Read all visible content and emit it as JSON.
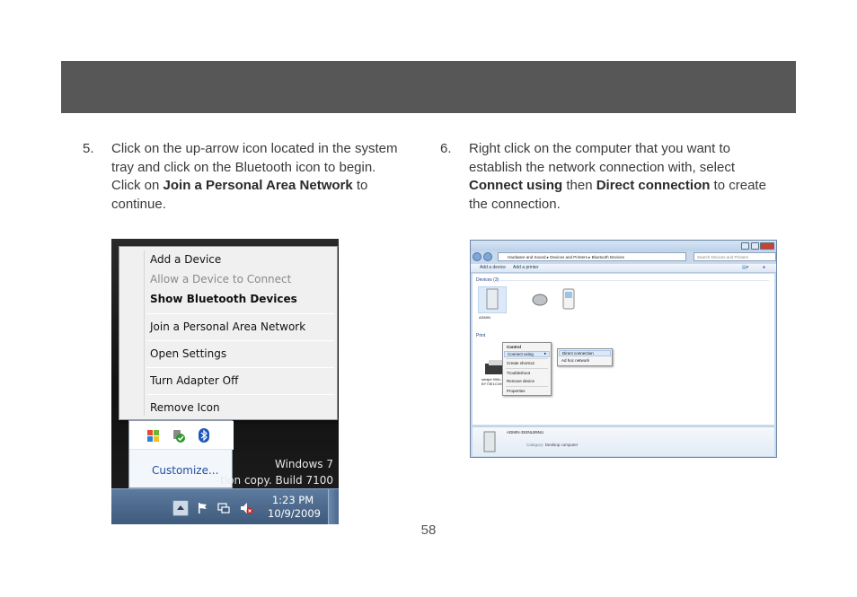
{
  "step5": {
    "number": "5.",
    "text_a": "Click on the up-arrow icon located in the system tray and click on the Bluetooth icon to begin.  Click on ",
    "bold_a": "Join a Personal Area Network",
    "text_b": " to continue."
  },
  "step6": {
    "number": "6.",
    "text_a": "Right click on the computer that you want to establish the network connection with, select ",
    "bold_a": "Connect using",
    "text_b": " then ",
    "bold_b": "Direct connection",
    "text_c": " to create the connection."
  },
  "bluetooth_menu": {
    "items": [
      "Add a Device",
      "Allow a Device to Connect",
      "Show Bluetooth Devices",
      "Join a Personal Area Network",
      "Open Settings",
      "Turn Adapter Off",
      "Remove Icon"
    ],
    "customize": "Customize...",
    "windows_line1": "Windows 7",
    "windows_line2": "tion copy. Build 7100",
    "clock_time": "1:23 PM",
    "clock_date": "10/9/2009"
  },
  "devices_window": {
    "breadcrumb": [
      "Hardware and Sound",
      "Devices and Printers",
      "Bluetooth Devices"
    ],
    "search_placeholder": "Search Devices and Printers",
    "toolbar_add_device": "Add a device",
    "toolbar_add_printer": "Add a printer",
    "group_devices": "Devices (3)",
    "group_printers": "Print",
    "device_label_computer": "ADMIN",
    "device_label_printer_1": "sledjet 995c S/N",
    "device_label_printer_2": "BY73E1C0X00L",
    "context_menu": [
      "Control",
      "Connect using",
      "Create shortcut",
      "Troubleshoot",
      "Remove device",
      "Properties"
    ],
    "submenu": [
      "Direct connection",
      "Ad hoc network"
    ],
    "details_name": "ADMIN-353NLB9NU",
    "details_category_label": "Category:",
    "details_category_value": "Desktop computer"
  },
  "page_number": "58"
}
